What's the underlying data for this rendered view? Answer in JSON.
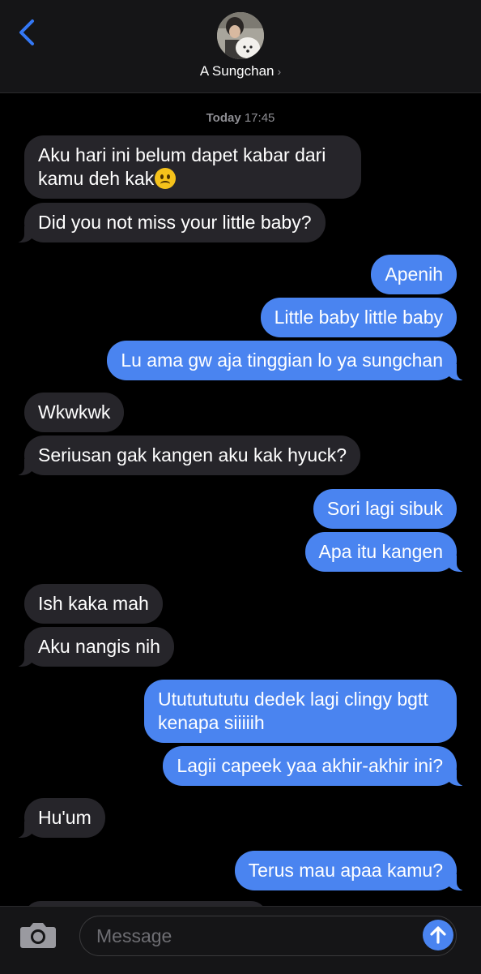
{
  "header": {
    "contact_name": "A Sungchan",
    "chevron": "›"
  },
  "timestamp": {
    "day": "Today",
    "time": "17:45"
  },
  "messages": [
    {
      "dir": "in",
      "text": "Aku hari ini belum dapet kabar dari kamu deh kak"
    },
    {
      "dir": "in",
      "text": "Did you not miss your little baby?"
    },
    {
      "dir": "out",
      "text": "Apenih"
    },
    {
      "dir": "out",
      "text": "Little baby little baby"
    },
    {
      "dir": "out",
      "text": "Lu ama gw aja tinggian lo ya sungchan"
    },
    {
      "dir": "in",
      "text": "Wkwkwk"
    },
    {
      "dir": "in",
      "text": "Seriusan gak kangen aku kak hyuck?"
    },
    {
      "dir": "out",
      "text": "Sori lagi sibuk"
    },
    {
      "dir": "out",
      "text": "Apa itu kangen"
    },
    {
      "dir": "in",
      "text": "Ish kaka mah"
    },
    {
      "dir": "in",
      "text": "Aku nangis nih"
    },
    {
      "dir": "out",
      "text": "Utututututu dedek lagi clingy bgtt kenapa siiiiih"
    },
    {
      "dir": "out",
      "text": "Lagii capeek yaa akhir-akhir ini?"
    },
    {
      "dir": "in",
      "text": "Hu'um"
    },
    {
      "dir": "out",
      "text": "Terus mau apaa kamu?"
    }
  ],
  "composer": {
    "placeholder": "Message"
  },
  "icons": {
    "back": "chevron-left-icon",
    "camera": "camera-icon",
    "send": "arrow-up-icon",
    "emoji": "frowning-face-emoji"
  },
  "colors": {
    "outgoing_bubble": "#4a84f0",
    "incoming_bubble": "#26252a",
    "accent": "#3478f6",
    "background": "#000000"
  }
}
